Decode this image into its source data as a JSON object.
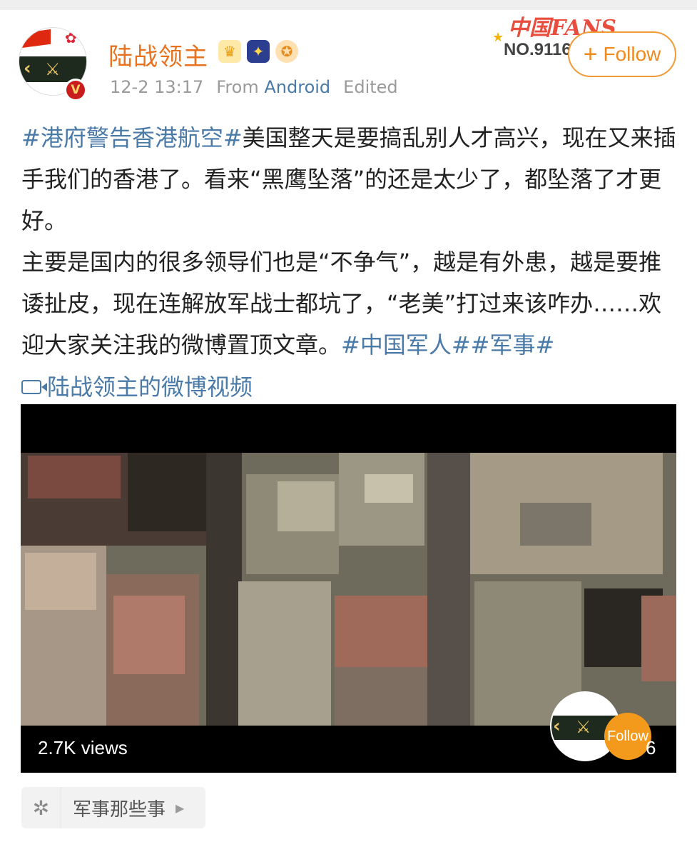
{
  "user": {
    "name": "陆战领主",
    "time": "12-2 13:17",
    "from_label": "From",
    "source": "Android",
    "edited": "Edited",
    "badges": [
      "crown-badge-icon",
      "star-badge-icon",
      "medal-badge-icon"
    ]
  },
  "fans_badge": {
    "title": "中国FANS",
    "number": "NO.9116"
  },
  "follow_button": {
    "plus": "+",
    "label": "Follow"
  },
  "post": {
    "tag1": "#港府警告香港航空#",
    "text1": "美国整天是要搞乱别人才高兴，现在又来插手我们的香港了。看来“黑鹰坠落”的还是太少了，都坠落了才更好。",
    "text2": "主要是国内的很多领导们也是“不争气”，越是有外患，越是要推诿扯皮，现在连解放军战士都坑了，“老美”打过来该咋办……欢迎大家关注我的微博置顶文章。",
    "tag2": "#中国军人#",
    "tag3": "#军事#",
    "video_link": "陆战领主的微博视频"
  },
  "video": {
    "views": "2.7K views",
    "follow": "Follow",
    "count_suffix": "6"
  },
  "topic": {
    "label": "军事那些事",
    "icon": "topic-dots-icon"
  },
  "colors": {
    "username": "#e8721d",
    "link": "#4a7aa8",
    "follow_accent": "#f08a1e",
    "meta": "#9a9a9a"
  }
}
